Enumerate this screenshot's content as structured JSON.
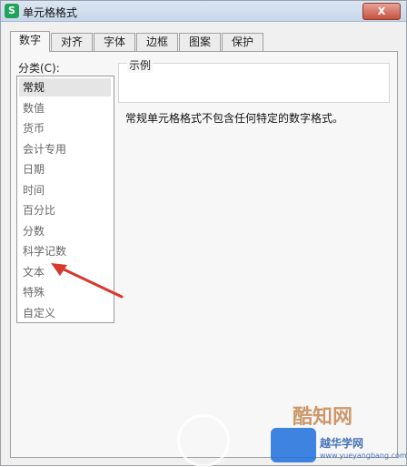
{
  "window": {
    "title": "单元格格式",
    "close_label": "X",
    "app_icon": "S"
  },
  "tabs": [
    "数字",
    "对齐",
    "字体",
    "边框",
    "图案",
    "保护"
  ],
  "category": {
    "label": "分类(C):",
    "items": [
      "常规",
      "数值",
      "货币",
      "会计专用",
      "日期",
      "时间",
      "百分比",
      "分数",
      "科学记数",
      "文本",
      "特殊",
      "自定义"
    ],
    "selected": "常规"
  },
  "sample": {
    "label": "示例",
    "value": ""
  },
  "description": "常规单元格格式不包含任何特定的数字格式。",
  "watermark": {
    "brand": "酷知网",
    "site_name": "越华学网",
    "site_url": "www.yueyangbang.com"
  },
  "colors": {
    "arrow": "#d63a2e"
  }
}
